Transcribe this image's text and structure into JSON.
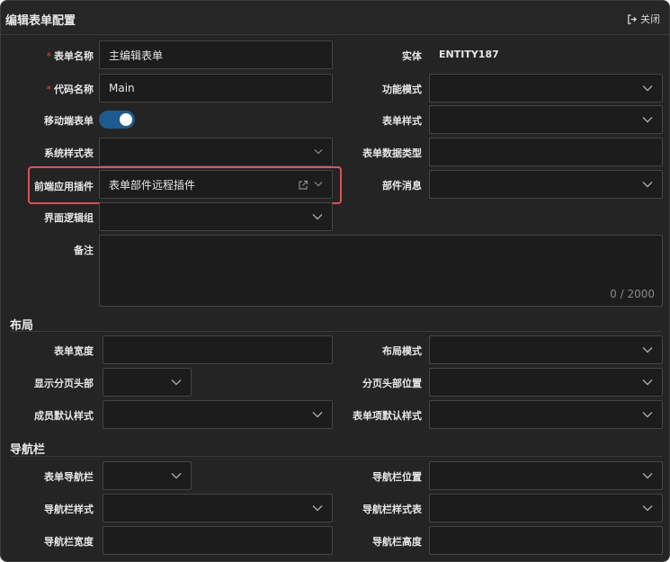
{
  "window": {
    "title": "编辑表单配置",
    "close_label": "关闭"
  },
  "basic": {
    "form_name": {
      "label": "表单名称",
      "required_mark": "*",
      "value": "主编辑表单"
    },
    "entity": {
      "label": "实体",
      "value": "ENTITY187"
    },
    "code_name": {
      "label": "代码名称",
      "required_mark": "*",
      "value": "Main"
    },
    "function_mode": {
      "label": "功能模式",
      "value": ""
    },
    "mobile_form": {
      "label": "移动端表单",
      "enabled": true
    },
    "form_style": {
      "label": "表单样式",
      "value": ""
    },
    "system_stylesheet": {
      "label": "系统样式表",
      "value": ""
    },
    "form_data_type": {
      "label": "表单数据类型",
      "value": ""
    },
    "frontend_plugin": {
      "label": "前端应用插件",
      "value": "表单部件远程插件"
    },
    "part_message": {
      "label": "部件消息",
      "value": ""
    },
    "ui_logic_group": {
      "label": "界面逻辑组",
      "value": ""
    },
    "remark": {
      "label": "备注",
      "value": "",
      "counter": "0 / 2000"
    }
  },
  "layout": {
    "section_title": "布局",
    "form_width": {
      "label": "表单宽度",
      "value": ""
    },
    "layout_mode": {
      "label": "布局模式",
      "value": ""
    },
    "show_page_header": {
      "label": "显示分页头部",
      "value": ""
    },
    "page_header_position": {
      "label": "分页头部位置",
      "value": ""
    },
    "member_default_style": {
      "label": "成员默认样式",
      "value": ""
    },
    "form_item_default_style": {
      "label": "表单项默认样式",
      "value": ""
    }
  },
  "navbar": {
    "section_title": "导航栏",
    "form_navbar": {
      "label": "表单导航栏",
      "value": ""
    },
    "navbar_position": {
      "label": "导航栏位置",
      "value": ""
    },
    "navbar_style": {
      "label": "导航栏样式",
      "value": ""
    },
    "navbar_stylesheet": {
      "label": "导航栏样式表",
      "value": ""
    },
    "navbar_width": {
      "label": "导航栏宽度",
      "value": ""
    },
    "navbar_height": {
      "label": "导航栏高度",
      "value": ""
    }
  },
  "icons": {
    "close": "sign-out-icon",
    "dropdown": "chevron-down-icon",
    "external": "external-link-icon"
  },
  "colors": {
    "accent": "#1d5a8e",
    "highlight": "#e0505a",
    "required": "#e04646"
  }
}
